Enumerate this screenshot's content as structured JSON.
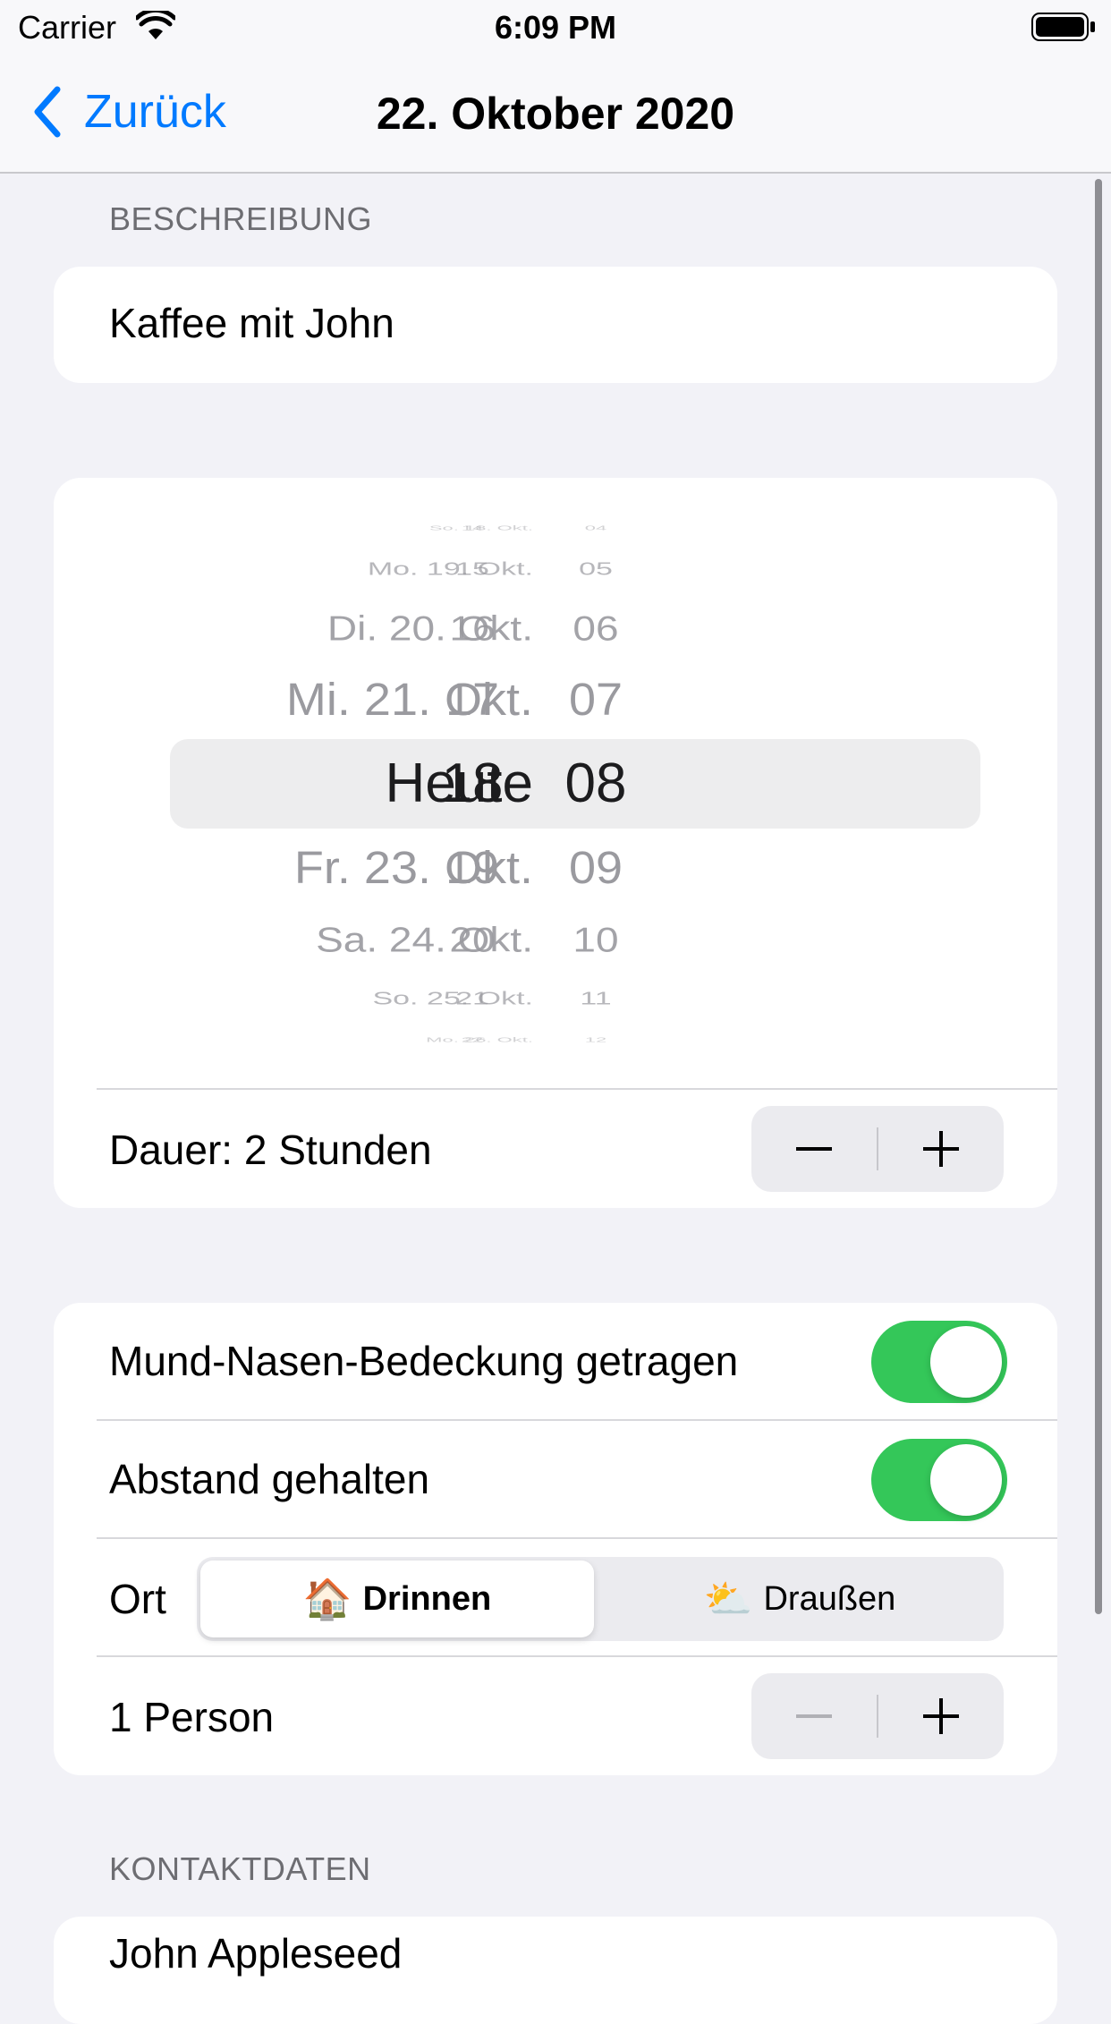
{
  "status_bar": {
    "carrier": "Carrier",
    "time": "6:09 PM"
  },
  "nav": {
    "back_label": "Zurück",
    "title": "22. Oktober 2020"
  },
  "description_section": {
    "header": "BESCHREIBUNG",
    "value": "Kaffee mit John"
  },
  "date_picker": {
    "dates": [
      "So. 18. Okt.",
      "Mo. 19. Okt.",
      "Di. 20. Okt.",
      "Mi. 21. Okt.",
      "Heute",
      "Fr. 23. Okt.",
      "Sa. 24. Okt.",
      "So. 25. Okt.",
      "Mo. 26. Okt."
    ],
    "hours": [
      "14",
      "15",
      "16",
      "17",
      "18",
      "19",
      "20",
      "21",
      "22"
    ],
    "minutes": [
      "04",
      "05",
      "06",
      "07",
      "08",
      "09",
      "10",
      "11",
      "12"
    ],
    "selected": {
      "date": "Heute",
      "hour": "18",
      "minute": "08"
    }
  },
  "duration": {
    "label": "Dauer: 2 Stunden"
  },
  "options": {
    "mask_label": "Mund-Nasen-Bedeckung getragen",
    "mask_on": true,
    "distance_label": "Abstand gehalten",
    "distance_on": true,
    "location_label": "Ort",
    "location_options": [
      {
        "emoji": "🏠",
        "label": "Drinnen",
        "selected": true
      },
      {
        "emoji": "⛅",
        "label": "Draußen",
        "selected": false
      }
    ],
    "persons_label": "1 Person"
  },
  "contact_section": {
    "header": "KONTAKTDATEN",
    "name": "John Appleseed"
  },
  "colors": {
    "accent": "#007aff",
    "toggle_on": "#34c759",
    "background": "#f2f2f7"
  }
}
